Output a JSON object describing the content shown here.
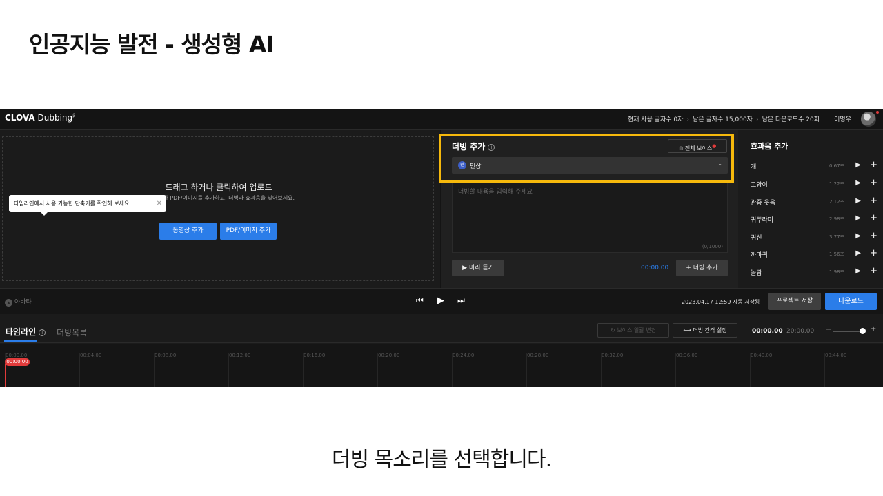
{
  "slide": {
    "title": "인공지능 발전 - 생성형 AI",
    "caption": "더빙 목소리를 선택합니다."
  },
  "header": {
    "logo_bold": "CLOVA",
    "logo_rest": "Dubbing",
    "logo_sup": "β",
    "stat_used": "현재 사용 글자수 0자",
    "stat_remaining": "남은 글자수 15,000자",
    "stat_downloads": "남은 다운로드수 20회",
    "user_name": "이명우"
  },
  "upload": {
    "title": "드래그 하거나 클릭하여 업로드",
    "subtitle": "동영상이나 PDF/이미지를 추가하고, 더빙과 효과음을 넣어보세요.",
    "video_button": "동영상 추가",
    "pdf_button": "PDF/이미지 추가"
  },
  "dubbing": {
    "heading": "더빙 추가",
    "all_voices_label": "전체 보이스",
    "voice_badge": "민",
    "voice_name": "민상",
    "text_placeholder": "더빙할 내용을 입력해 주세요",
    "char_count": "(0/1000)",
    "preview_label": "미리 듣기",
    "time": "00:00.00",
    "add_label": "더빙 추가"
  },
  "sfx": {
    "heading": "효과음 추가",
    "items": [
      {
        "name": "개",
        "duration": "0.67초"
      },
      {
        "name": "고양이",
        "duration": "1.22초"
      },
      {
        "name": "관중 웃음",
        "duration": "2.12초"
      },
      {
        "name": "귀뚜라미",
        "duration": "2.98초"
      },
      {
        "name": "귀신",
        "duration": "3.77초"
      },
      {
        "name": "까마귀",
        "duration": "1.56초"
      },
      {
        "name": "놀람",
        "duration": "1.98초"
      }
    ]
  },
  "playbar": {
    "avatar_label": "아바타",
    "saved_text": "2023.04.17 12:59 자동 저장됨",
    "save_project": "프로젝트 저장",
    "download": "다운로드"
  },
  "tooltip": {
    "text": "타임라인에서 사용 가능한 단축키를 확인해 보세요."
  },
  "timeline": {
    "tab_timeline": "타임라인",
    "tab_dub_list": "더빙목록",
    "change_voice": "보이스 일괄 변경",
    "dub_interval": "더빙 간격 설정",
    "current_time": "00:00.00",
    "total_time": "20:00.00",
    "zoom_level": 0.8,
    "playhead": "00:00.00",
    "ticks": [
      "00:00.00",
      "00:04.00",
      "00:08.00",
      "00:12.00",
      "00:16.00",
      "00:20.00",
      "00:24.00",
      "00:28.00",
      "00:32.00",
      "00:36.00",
      "00:40.00",
      "00:44.00"
    ]
  },
  "colors": {
    "accent": "#2b7de9",
    "highlight": "#f6b90c",
    "playhead": "#e23b3b"
  }
}
